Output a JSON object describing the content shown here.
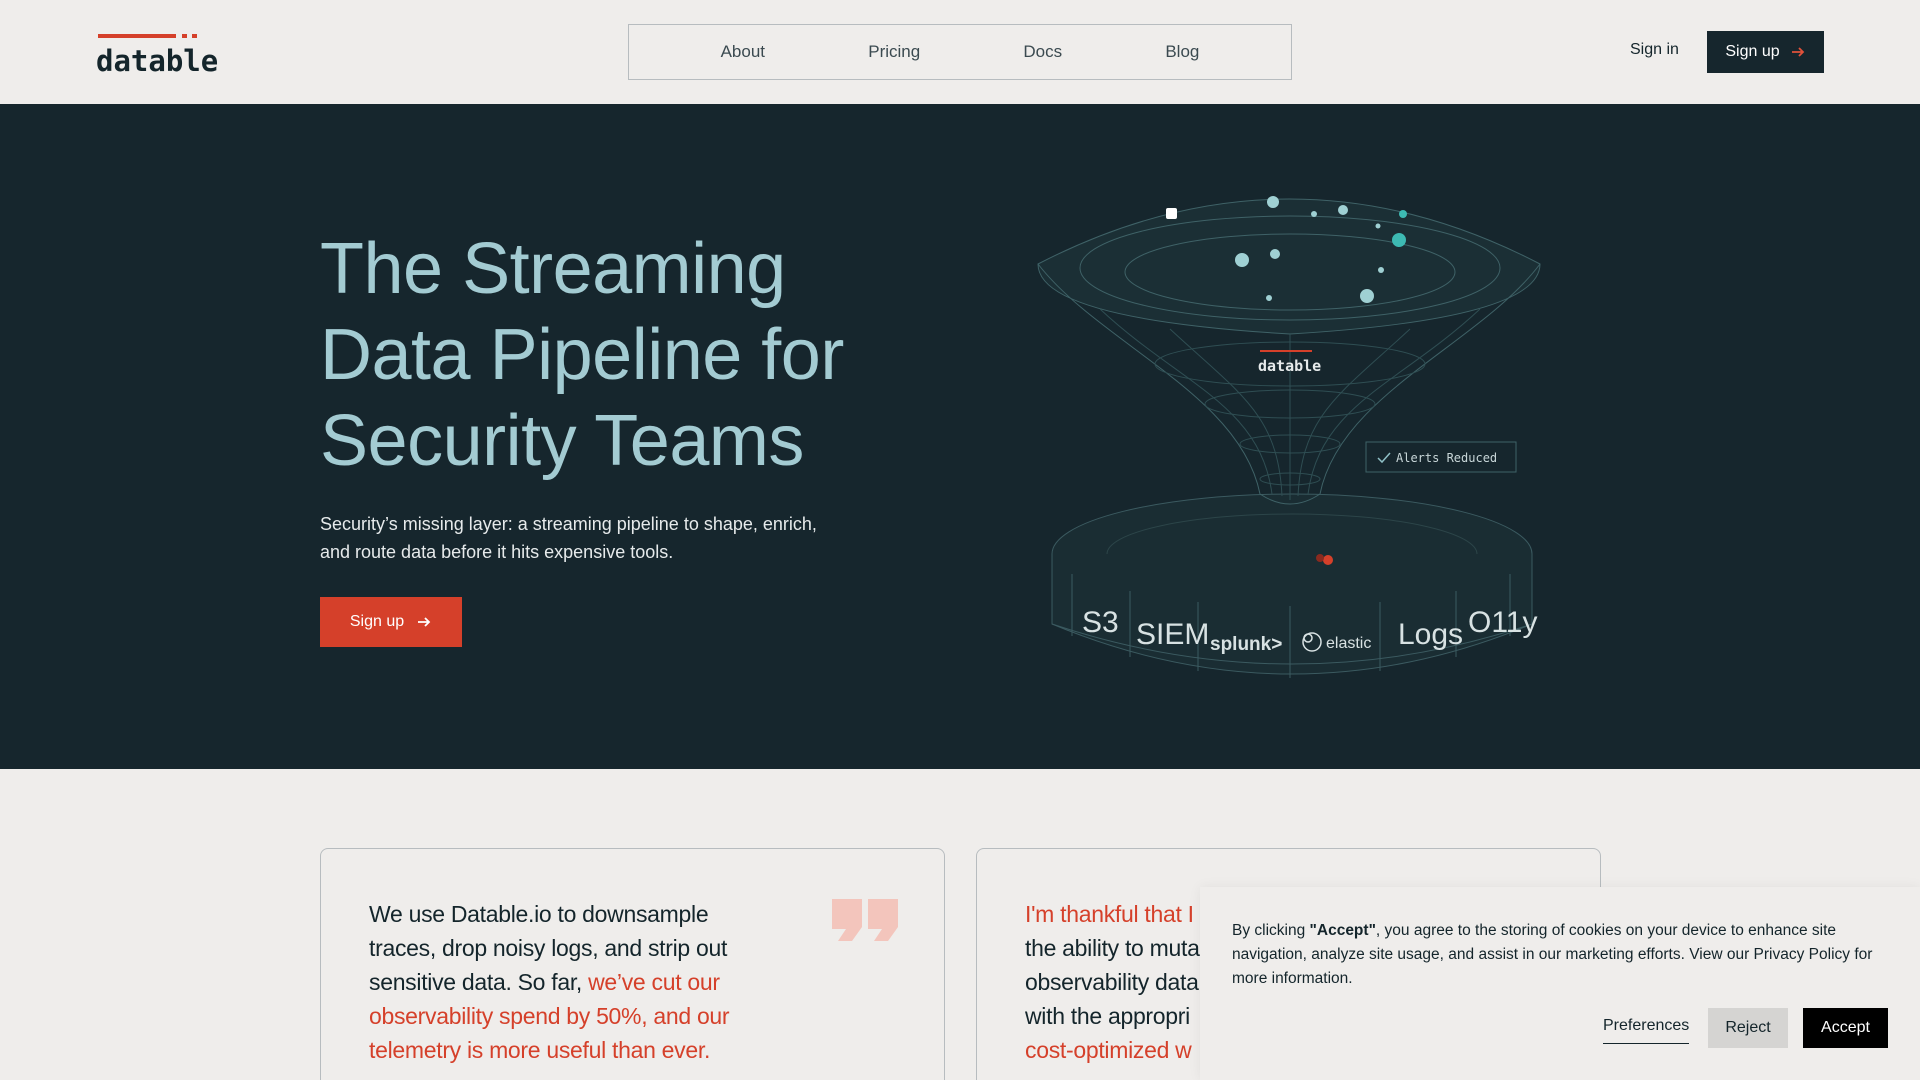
{
  "header": {
    "logo_text": "datable",
    "nav": [
      "About",
      "Pricing",
      "Docs",
      "Blog"
    ],
    "signin_label": "Sign in",
    "signup_label": "Sign up"
  },
  "hero": {
    "title": "The Streaming Data Pipeline for Security Teams",
    "subtitle": "Security’s missing layer: a streaming pipeline to shape, enrich, and route data before it hits expensive tools.",
    "cta_label": "Sign up",
    "illustration": {
      "center_logo": "datable",
      "badge": "Alerts Reduced",
      "destinations": [
        "S3",
        "SIEM",
        "splunk>",
        "elastic",
        "Logs",
        "O11y"
      ]
    }
  },
  "testimonials": [
    {
      "text_plain": "We use Datable.io to downsample traces, drop noisy logs, and strip out sensitive data. So far, ",
      "text_highlight": "we’ve cut our observability spend by 50%, and our telemetry is more useful than ever."
    },
    {
      "text_highlight_start": "I'm thankful that I",
      "text_lines": [
        "the ability to muta",
        "observability data",
        "with the appropri"
      ],
      "text_highlight_end": "cost-optimized w"
    }
  ],
  "cookie": {
    "text_before": "By clicking ",
    "text_bold": "\"Accept\"",
    "text_after": ", you agree to the storing of cookies on your device to enhance site navigation, analyze site usage, and assist in our marketing efforts. View our Privacy Policy for more information.",
    "preferences_label": "Preferences",
    "reject_label": "Reject",
    "accept_label": "Accept"
  },
  "colors": {
    "accent": "#d5402a",
    "dark": "#16262d",
    "hero_title": "#a3cbd2",
    "page_bg": "#efedeb"
  }
}
